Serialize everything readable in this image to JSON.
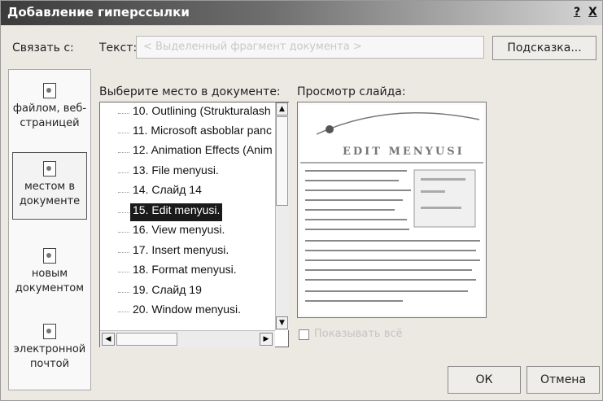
{
  "dialog": {
    "title": "Добавление гиперссылки",
    "help_button": "?",
    "close_button": "X"
  },
  "link_to": {
    "label": "Связать с:",
    "items": [
      {
        "label": "файлом, веб-страницей",
        "icon": "file-icon"
      },
      {
        "label": "местом в документе",
        "icon": "place-icon"
      },
      {
        "label": "новым документом",
        "icon": "new-doc-icon"
      },
      {
        "label": "электронной почтой",
        "icon": "email-icon"
      }
    ]
  },
  "text_field": {
    "label": "Текст:",
    "value": "< Выделенный фрагмент документа >"
  },
  "tooltip_button": "Подсказка...",
  "place": {
    "label": "Выберите место в документе:",
    "items": [
      "10. Outlining (Strukturalash",
      "11. Microsoft  asboblar panc",
      "12. Animation Effects (Anim",
      "13.  File menyusi.",
      "14. Слайд 14",
      "15. Edit  menyusi.",
      "16. View   menyusi.",
      "17. Insert  menyusi.",
      "18. Format menyusi.",
      "19. Слайд 19",
      "20. Window  menyusi."
    ],
    "selected_index": 5
  },
  "preview": {
    "label": "Просмотр слайда:",
    "slide_title": "EDIT MENYUSI"
  },
  "show_all": {
    "label": "Показывать всё",
    "checked": false
  },
  "buttons": {
    "ok": "ОК",
    "cancel": "Отмена"
  }
}
